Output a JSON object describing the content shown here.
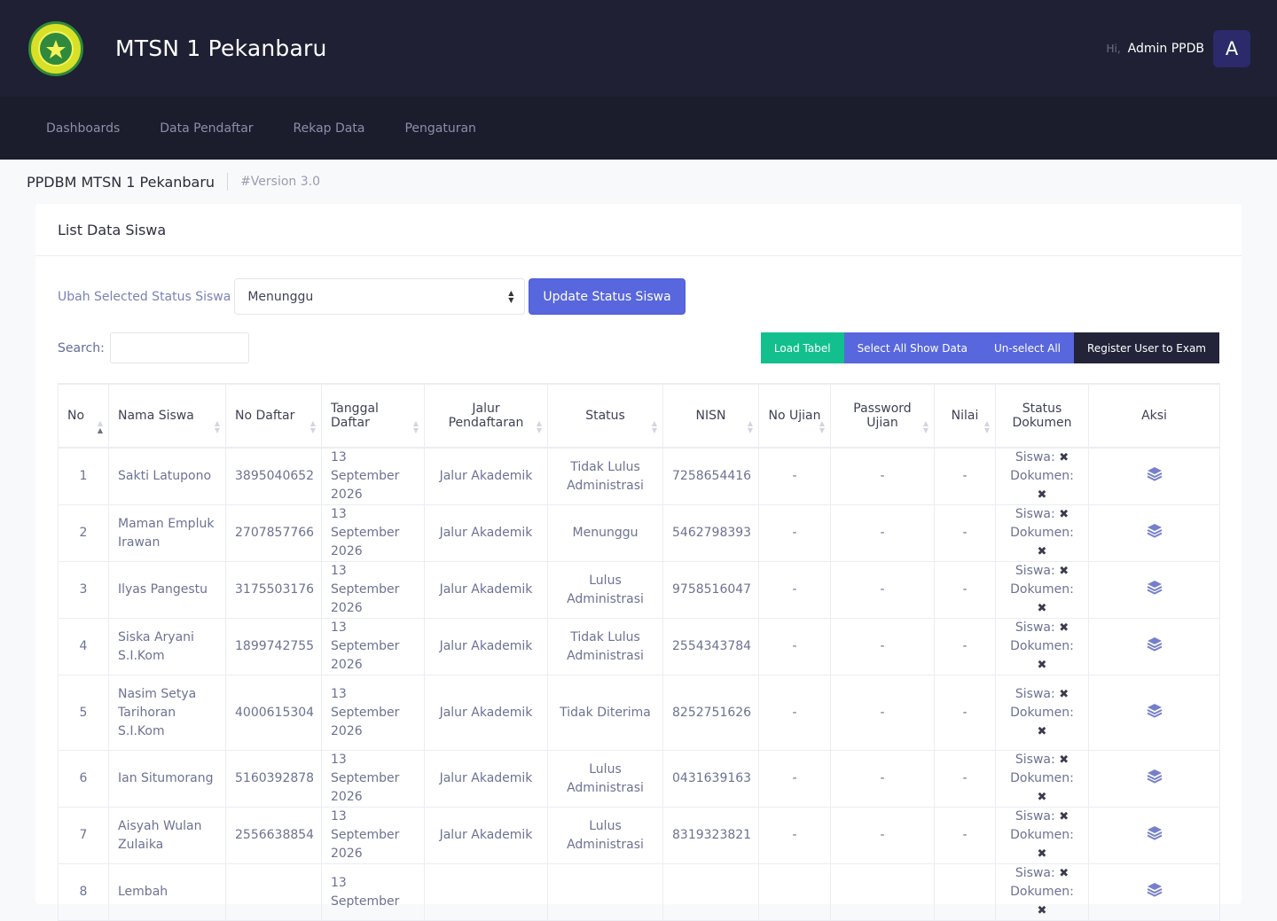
{
  "header": {
    "app_title": "MTSN 1 Pekanbaru",
    "greeting": "Hi,",
    "user_name": "Admin PPDB",
    "avatar_letter": "A"
  },
  "nav": {
    "items": [
      "Dashboards",
      "Data Pendaftar",
      "Rekap Data",
      "Pengaturan"
    ]
  },
  "subheader": {
    "title": "PPDBM MTSN 1 Pekanbaru",
    "version": "#Version 3.0"
  },
  "card": {
    "title": "List Data Siswa",
    "status_label": "Ubah Selected Status Siswa",
    "status_value": "Menunggu",
    "update_button": "Update Status Siswa",
    "search_label": "Search:",
    "buttons": {
      "load": "Load Tabel",
      "select_all": "Select All Show Data",
      "unselect": "Un-select All",
      "register": "Register User to Exam"
    }
  },
  "table": {
    "columns": [
      "No",
      "Nama Siswa",
      "No Daftar",
      "Tanggal Daftar",
      "Jalur Pendaftaran",
      "Status",
      "NISN",
      "No Ujian",
      "Password Ujian",
      "Nilai",
      "Status Dokumen",
      "Aksi"
    ],
    "doc_labels": {
      "siswa": "Siswa:",
      "dokumen": "Dokumen:",
      "mark": "✖"
    },
    "rows": [
      {
        "no": "1",
        "nama": "Sakti Latupono",
        "daftar": "3895040652",
        "tanggal": "13 September 2026",
        "jalur": "Jalur Akademik",
        "status": "Tidak Lulus Administrasi",
        "nisn": "7258654416",
        "ujian": "-",
        "password": "-",
        "nilai": "-"
      },
      {
        "no": "2",
        "nama": "Maman Empluk Irawan",
        "daftar": "2707857766",
        "tanggal": "13 September 2026",
        "jalur": "Jalur Akademik",
        "status": "Menunggu",
        "nisn": "5462798393",
        "ujian": "-",
        "password": "-",
        "nilai": "-"
      },
      {
        "no": "3",
        "nama": "Ilyas Pangestu",
        "daftar": "3175503176",
        "tanggal": "13 September 2026",
        "jalur": "Jalur Akademik",
        "status": "Lulus Administrasi",
        "nisn": "9758516047",
        "ujian": "-",
        "password": "-",
        "nilai": "-"
      },
      {
        "no": "4",
        "nama": "Siska Aryani S.I.Kom",
        "daftar": "1899742755",
        "tanggal": "13 September 2026",
        "jalur": "Jalur Akademik",
        "status": "Tidak Lulus Administrasi",
        "nisn": "2554343784",
        "ujian": "-",
        "password": "-",
        "nilai": "-"
      },
      {
        "no": "5",
        "nama": "Nasim Setya Tarihoran S.I.Kom",
        "daftar": "4000615304",
        "tanggal": "13 September 2026",
        "jalur": "Jalur Akademik",
        "status": "Tidak Diterima",
        "nisn": "8252751626",
        "ujian": "-",
        "password": "-",
        "nilai": "-"
      },
      {
        "no": "6",
        "nama": "Ian Situmorang",
        "daftar": "5160392878",
        "tanggal": "13 September 2026",
        "jalur": "Jalur Akademik",
        "status": "Lulus Administrasi",
        "nisn": "0431639163",
        "ujian": "-",
        "password": "-",
        "nilai": "-"
      },
      {
        "no": "7",
        "nama": "Aisyah Wulan Zulaika",
        "daftar": "2556638854",
        "tanggal": "13 September 2026",
        "jalur": "Jalur Akademik",
        "status": "Lulus Administrasi",
        "nisn": "8319323821",
        "ujian": "-",
        "password": "-",
        "nilai": "-"
      },
      {
        "no": "8",
        "nama": "Lembah",
        "daftar": "",
        "tanggal": "13 September",
        "jalur": "",
        "status": "",
        "nisn": "",
        "ujian": "",
        "password": "",
        "nilai": ""
      }
    ]
  },
  "colors": {
    "header_bg": "#1f2033",
    "nav_bg": "#1b1c2c",
    "primary": "#5867dd",
    "success": "#13bf8d",
    "dark": "#23243a"
  }
}
